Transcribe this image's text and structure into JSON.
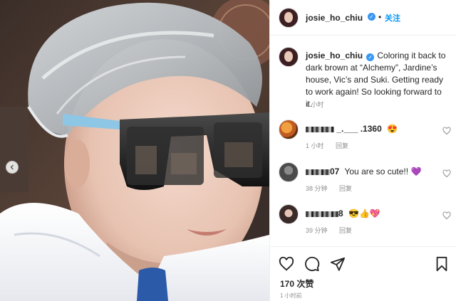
{
  "post": {
    "author": "josie_ho_chiu",
    "verified_badge": "✓",
    "follow_label": "关注",
    "caption": "Coloring it back to dark brown at “Alchemy”, Jardine’s house, Vic’s and Suki. Getting ready to work again! So looking forward to it.",
    "caption_time": "1 小时",
    "likes": "170 次赞",
    "post_time": "1 小时前"
  },
  "comments": [
    {
      "user_visible": "_.___ .1360",
      "text": "😍",
      "time": "1 小时",
      "reply_label": "回复"
    },
    {
      "user_visible": "07",
      "text": "You are so cute!! 💜",
      "time": "38 分钟",
      "reply_label": "回复"
    },
    {
      "user_visible": "8",
      "text": "😎👍💖",
      "time": "39 分钟",
      "reply_label": "回复"
    }
  ],
  "icons": {
    "like": "heart-icon",
    "comment": "comment-icon",
    "share": "share-icon",
    "save": "bookmark-icon",
    "carousel_prev": "chevron-left-icon"
  },
  "colors": {
    "accent": "#0095f6",
    "verified": "#3897f0",
    "muted_text": "#8e8e8e",
    "comment2_emoji": "#9b4dca"
  }
}
